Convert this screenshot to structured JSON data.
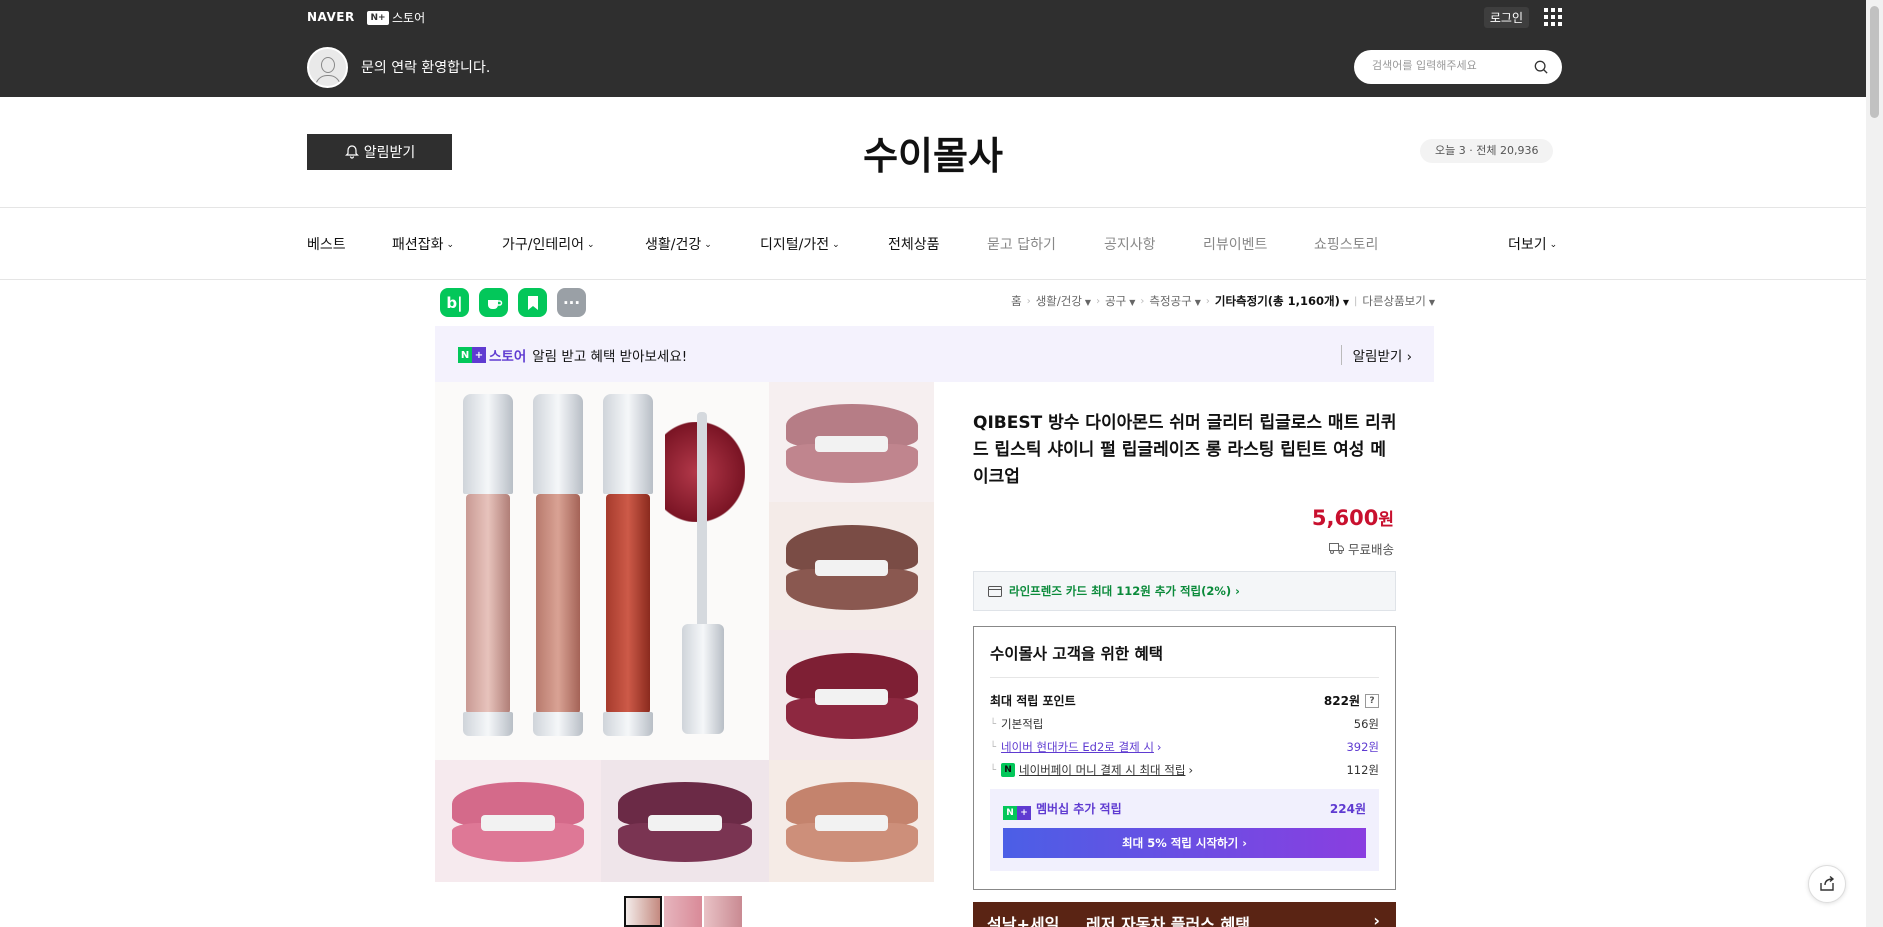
{
  "topbar": {
    "naver_logo": "NAVER",
    "nstore_box": "N+",
    "nstore_label": "스토어",
    "login": "로그인",
    "welcome": "문의 연락 환영합니다.",
    "search_placeholder": "검색어를 입력해주세요"
  },
  "store": {
    "alarm_button": "알림받기",
    "name": "수이몰사",
    "visit_count": "오늘 3 · 전체 20,936"
  },
  "nav": {
    "items": [
      {
        "label": "베스트",
        "dropdown": false
      },
      {
        "label": "패션잡화",
        "dropdown": true
      },
      {
        "label": "가구/인테리어",
        "dropdown": true
      },
      {
        "label": "생활/건강",
        "dropdown": true
      },
      {
        "label": "디지털/가전",
        "dropdown": true
      },
      {
        "label": "전체상품",
        "dropdown": false
      },
      {
        "label": "묻고 답하기",
        "dropdown": false
      },
      {
        "label": "공지사항",
        "dropdown": false
      },
      {
        "label": "리뷰이벤트",
        "dropdown": false
      },
      {
        "label": "쇼핑스토리",
        "dropdown": false
      }
    ],
    "more": "더보기"
  },
  "social": {
    "blog": "b|",
    "more": "···"
  },
  "breadcrumb": {
    "home": "홈",
    "c1": "생활/건강",
    "c2": "공구",
    "c3": "측정공구",
    "c4": "기타측정기(총 1,160개)",
    "other": "다른상품보기"
  },
  "promo": {
    "store_label": "스토어",
    "message": "알림 받고 혜택 받아보세요!",
    "action": "알림받기 ›"
  },
  "product": {
    "title": "QIBEST 방수 다이아몬드 쉬머 글리터 립글로스 매트 리퀴드 립스틱 샤이니 펄 립글레이즈 롱 라스팅 립틴트 여성 메이크업",
    "price": "5,600",
    "price_unit": "원",
    "shipping": "무료배송",
    "card_benefit": "라인프렌즈 카드 최대 112원 추가 적립(2%) ›"
  },
  "benefits": {
    "heading": "수이몰사 고객을 위한 혜택",
    "max_points_label": "최대 적립 포인트",
    "max_points_value": "822원",
    "qmark": "?",
    "basic_label": "기본적립",
    "basic_value": "56원",
    "card_label": "네이버 현대카드 Ed2로 결제 시",
    "card_value": "392원",
    "npay_label": "네이버페이 머니 결제 시 최대 적립",
    "npay_value": "112원",
    "membership_label": "멤버십 추가 적립",
    "membership_value": "224원",
    "cta": "최대 5% 적립 시작하기 ›"
  },
  "sale_banner": {
    "t1": "설날+세일",
    "t2": "레저 자동차 플러스 혜택"
  },
  "colors": {
    "topbar": "#2f2f2f",
    "price": "#c8102e",
    "naver_green": "#03c75a",
    "membership_purple": "#5f3bd1"
  }
}
